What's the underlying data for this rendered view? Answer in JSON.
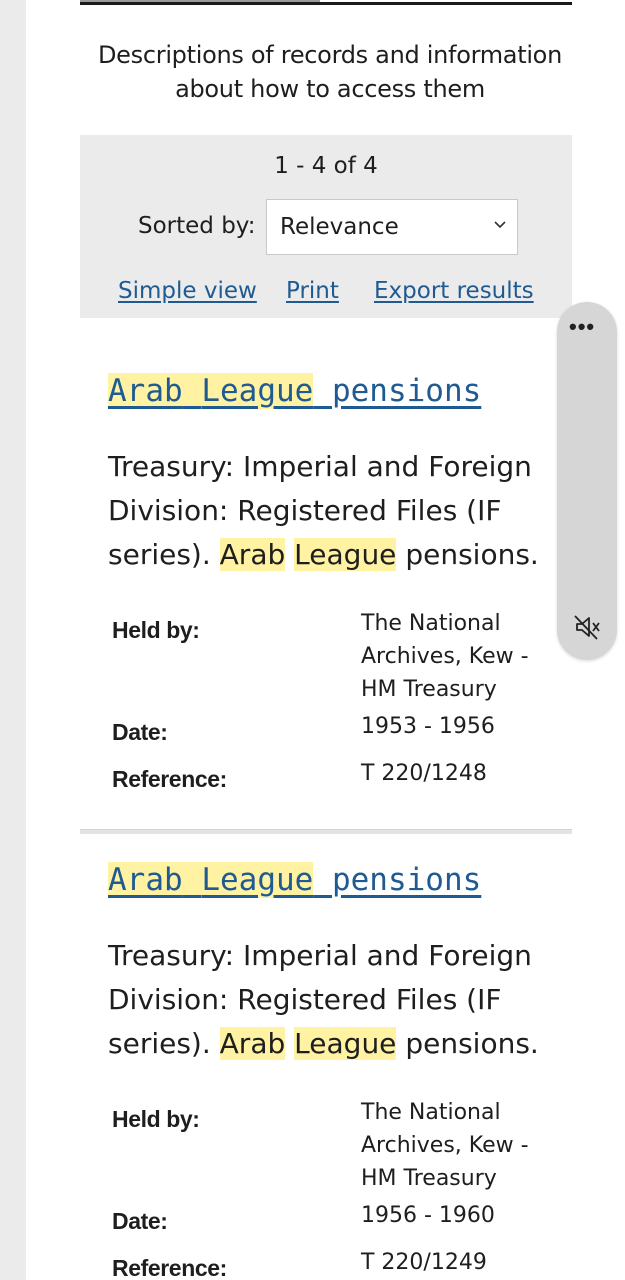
{
  "description": "Descriptions of records and information about how to access them",
  "results": {
    "count_text": "1 - 4 of 4",
    "sort_label": "Sorted by:",
    "sort_value": "Relevance",
    "links": [
      "Simple view",
      "Print",
      "Export results"
    ]
  },
  "records": [
    {
      "title_words": [
        "Arab",
        "League",
        "pensions"
      ],
      "title_highlighted": [
        true,
        true,
        false
      ],
      "desc_prefix": "Treasury: Imperial and Foreign Division: Registered Files (IF series).",
      "desc_hl1": "Arab",
      "desc_hl2": "League",
      "desc_suffix": "pensions.",
      "held_by_label": "Held by:",
      "held_by_lines": [
        "The National",
        "Archives, Kew -",
        "HM Treasury"
      ],
      "date_label": "Date:",
      "date": "1953 - 1956",
      "reference_label": "Reference:",
      "reference": "T 220/1248"
    },
    {
      "title_words": [
        "Arab",
        "League",
        "pensions"
      ],
      "title_highlighted": [
        true,
        true,
        false
      ],
      "desc_prefix": "Treasury: Imperial and Foreign Division: Registered Files (IF series).",
      "desc_hl1": "Arab",
      "desc_hl2": "League",
      "desc_suffix": "pensions.",
      "held_by_label": "Held by:",
      "held_by_lines": [
        "The National",
        "Archives, Kew -",
        "HM Treasury"
      ],
      "date_label": "Date:",
      "date": "1956 - 1960",
      "reference_label": "Reference:",
      "reference": "T 220/1249"
    }
  ],
  "overlay": {
    "menu_icon": "more-dots-icon",
    "mute_icon": "volume-mute-icon"
  },
  "colors": {
    "link": "#1f5a92",
    "highlight": "#fff2a2",
    "panel": "#ebebeb"
  }
}
